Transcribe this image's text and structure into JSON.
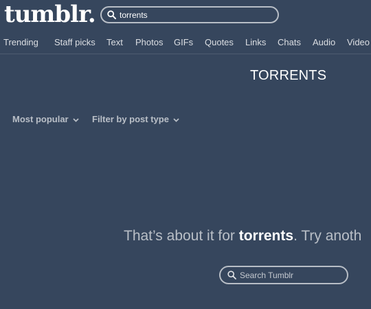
{
  "header": {
    "logo": "tumblr.",
    "search": {
      "value": "torrents"
    }
  },
  "nav": {
    "items": [
      "Trending",
      "Staff picks",
      "Text",
      "Photos",
      "GIFs",
      "Quotes",
      "Links",
      "Chats",
      "Audio",
      "Video"
    ]
  },
  "main": {
    "title": "TORRENTS",
    "filters": {
      "sort_label": "Most popular",
      "type_label": "Filter by post type"
    },
    "empty": {
      "prefix": "That’s about it for ",
      "term": "torrents",
      "suffix": ". Try anoth"
    },
    "search": {
      "placeholder": "Search Tumblr"
    }
  },
  "colors": {
    "background": "#36465d",
    "text": "#ffffff"
  },
  "icons": {
    "search": "search-icon",
    "chevron": "chevron-down-icon"
  }
}
